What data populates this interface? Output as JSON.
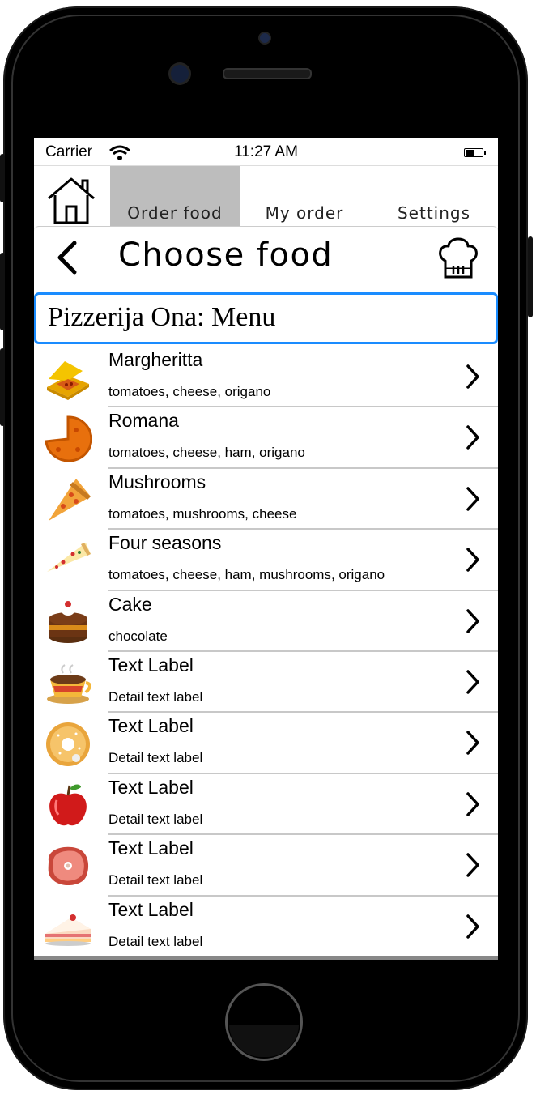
{
  "status_bar": {
    "carrier": "Carrier",
    "time": "11:27 AM"
  },
  "tabs": [
    {
      "label": "Order food",
      "active": true
    },
    {
      "label": "My order",
      "active": false
    },
    {
      "label": "Settings",
      "active": false
    }
  ],
  "nav": {
    "title": "Choose food"
  },
  "menu": {
    "heading": "Pizzerija Ona: Menu"
  },
  "items": [
    {
      "title": "Margheritta",
      "detail": "tomatoes, cheese, origano",
      "icon": "pizza-box-icon"
    },
    {
      "title": "Romana",
      "detail": "tomatoes, cheese, ham, origano",
      "icon": "pizza-icon"
    },
    {
      "title": "Mushrooms",
      "detail": "tomatoes, mushrooms, cheese",
      "icon": "pizza-slice-icon"
    },
    {
      "title": "Four seasons",
      "detail": "tomatoes, cheese, ham, mushrooms, origano",
      "icon": "pizza-slice-icon"
    },
    {
      "title": "Cake",
      "detail": "chocolate",
      "icon": "chocolate-cake-icon"
    },
    {
      "title": "Text Label",
      "detail": "Detail text label",
      "icon": "coffee-cup-icon"
    },
    {
      "title": "Text Label",
      "detail": "Detail text label",
      "icon": "bagel-icon"
    },
    {
      "title": "Text Label",
      "detail": "Detail text label",
      "icon": "apple-icon"
    },
    {
      "title": "Text Label",
      "detail": "Detail text label",
      "icon": "ham-steak-icon"
    },
    {
      "title": "Text Label",
      "detail": "Detail text label",
      "icon": "cake-slice-icon"
    }
  ],
  "colors": {
    "accent": "#1a8cff",
    "active_tab": "#bdbdbd",
    "separator": "#c8c8c8"
  }
}
